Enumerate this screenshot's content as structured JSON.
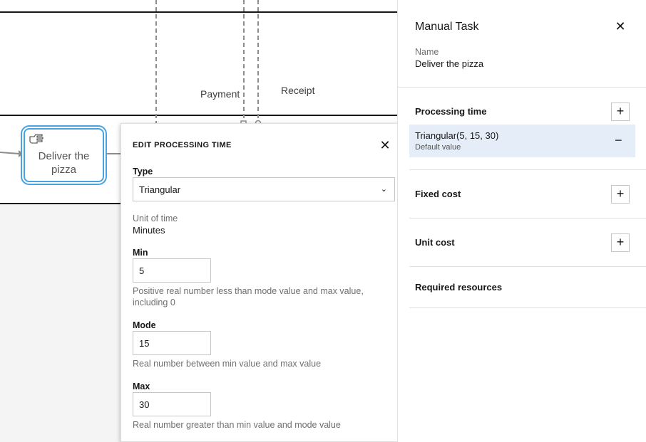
{
  "canvas": {
    "flow_labels": {
      "payment": "Payment",
      "receipt": "Receipt"
    },
    "task": {
      "label": "Deliver the pizza",
      "icon": "hand-icon"
    }
  },
  "popover": {
    "title": "EDIT PROCESSING TIME",
    "close_icon": "close-icon",
    "type_label": "Type",
    "type_value": "Triangular",
    "unit_label": "Unit of time",
    "unit_value": "Minutes",
    "min_label": "Min",
    "min_value": "5",
    "min_helper": "Positive real number less than mode value and max value, including 0",
    "mode_label": "Mode",
    "mode_value": "15",
    "mode_helper": "Real number between min value and max value",
    "max_label": "Max",
    "max_value": "30",
    "max_helper": "Real number greater than min value and mode value"
  },
  "panel": {
    "title": "Manual Task",
    "name_label": "Name",
    "name_value": "Deliver the pizza",
    "processing_time": {
      "title": "Processing time",
      "value": "Triangular(5, 15, 30)",
      "sub": "Default value"
    },
    "fixed_cost": "Fixed cost",
    "unit_cost": "Unit cost",
    "required_resources": "Required resources"
  },
  "colors": {
    "selection": "#4aa3df",
    "row_highlight": "#e5eef8",
    "canvas_bg": "#f4f4f4"
  }
}
